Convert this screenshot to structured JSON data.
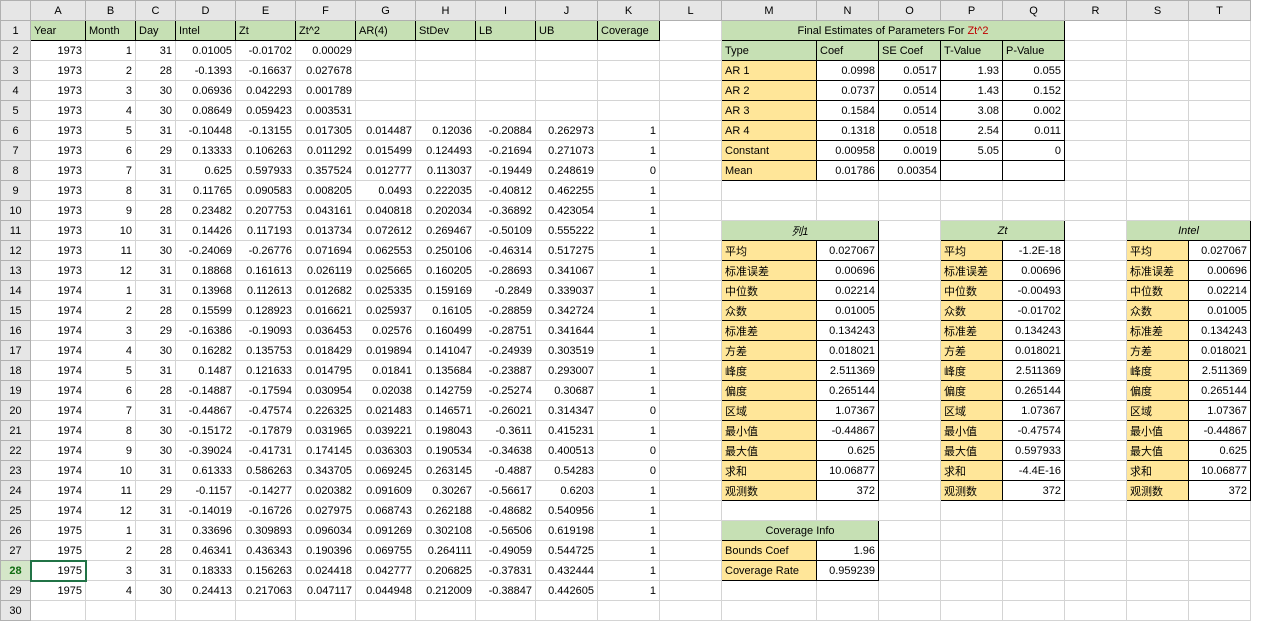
{
  "columns": [
    "A",
    "B",
    "C",
    "D",
    "E",
    "F",
    "G",
    "H",
    "I",
    "J",
    "K",
    "L",
    "M",
    "N",
    "O",
    "P",
    "Q",
    "R",
    "S",
    "T"
  ],
  "headers": {
    "A": "Year",
    "B": "Month",
    "C": "Day",
    "D": "Intel",
    "E": "Zt",
    "F": "Zt^2",
    "G": "AR(4)",
    "H": "StDev",
    "I": "LB",
    "J": "UB",
    "K": "Coverage"
  },
  "rows": [
    {
      "r": 2,
      "A": "1973",
      "B": "1",
      "C": "31",
      "D": "0.01005",
      "E": "-0.01702",
      "F": "0.00029"
    },
    {
      "r": 3,
      "A": "1973",
      "B": "2",
      "C": "28",
      "D": "-0.1393",
      "E": "-0.16637",
      "F": "0.027678"
    },
    {
      "r": 4,
      "A": "1973",
      "B": "3",
      "C": "30",
      "D": "0.06936",
      "E": "0.042293",
      "F": "0.001789"
    },
    {
      "r": 5,
      "A": "1973",
      "B": "4",
      "C": "30",
      "D": "0.08649",
      "E": "0.059423",
      "F": "0.003531"
    },
    {
      "r": 6,
      "A": "1973",
      "B": "5",
      "C": "31",
      "D": "-0.10448",
      "E": "-0.13155",
      "F": "0.017305",
      "G": "0.014487",
      "H": "0.12036",
      "I": "-0.20884",
      "J": "0.262973",
      "K": "1"
    },
    {
      "r": 7,
      "A": "1973",
      "B": "6",
      "C": "29",
      "D": "0.13333",
      "E": "0.106263",
      "F": "0.011292",
      "G": "0.015499",
      "H": "0.124493",
      "I": "-0.21694",
      "J": "0.271073",
      "K": "1"
    },
    {
      "r": 8,
      "A": "1973",
      "B": "7",
      "C": "31",
      "D": "0.625",
      "E": "0.597933",
      "F": "0.357524",
      "G": "0.012777",
      "H": "0.113037",
      "I": "-0.19449",
      "J": "0.248619",
      "K": "0"
    },
    {
      "r": 9,
      "A": "1973",
      "B": "8",
      "C": "31",
      "D": "0.11765",
      "E": "0.090583",
      "F": "0.008205",
      "G": "0.0493",
      "H": "0.222035",
      "I": "-0.40812",
      "J": "0.462255",
      "K": "1"
    },
    {
      "r": 10,
      "A": "1973",
      "B": "9",
      "C": "28",
      "D": "0.23482",
      "E": "0.207753",
      "F": "0.043161",
      "G": "0.040818",
      "H": "0.202034",
      "I": "-0.36892",
      "J": "0.423054",
      "K": "1"
    },
    {
      "r": 11,
      "A": "1973",
      "B": "10",
      "C": "31",
      "D": "0.14426",
      "E": "0.117193",
      "F": "0.013734",
      "G": "0.072612",
      "H": "0.269467",
      "I": "-0.50109",
      "J": "0.555222",
      "K": "1"
    },
    {
      "r": 12,
      "A": "1973",
      "B": "11",
      "C": "30",
      "D": "-0.24069",
      "E": "-0.26776",
      "F": "0.071694",
      "G": "0.062553",
      "H": "0.250106",
      "I": "-0.46314",
      "J": "0.517275",
      "K": "1"
    },
    {
      "r": 13,
      "A": "1973",
      "B": "12",
      "C": "31",
      "D": "0.18868",
      "E": "0.161613",
      "F": "0.026119",
      "G": "0.025665",
      "H": "0.160205",
      "I": "-0.28693",
      "J": "0.341067",
      "K": "1"
    },
    {
      "r": 14,
      "A": "1974",
      "B": "1",
      "C": "31",
      "D": "0.13968",
      "E": "0.112613",
      "F": "0.012682",
      "G": "0.025335",
      "H": "0.159169",
      "I": "-0.2849",
      "J": "0.339037",
      "K": "1"
    },
    {
      "r": 15,
      "A": "1974",
      "B": "2",
      "C": "28",
      "D": "0.15599",
      "E": "0.128923",
      "F": "0.016621",
      "G": "0.025937",
      "H": "0.16105",
      "I": "-0.28859",
      "J": "0.342724",
      "K": "1"
    },
    {
      "r": 16,
      "A": "1974",
      "B": "3",
      "C": "29",
      "D": "-0.16386",
      "E": "-0.19093",
      "F": "0.036453",
      "G": "0.02576",
      "H": "0.160499",
      "I": "-0.28751",
      "J": "0.341644",
      "K": "1"
    },
    {
      "r": 17,
      "A": "1974",
      "B": "4",
      "C": "30",
      "D": "0.16282",
      "E": "0.135753",
      "F": "0.018429",
      "G": "0.019894",
      "H": "0.141047",
      "I": "-0.24939",
      "J": "0.303519",
      "K": "1"
    },
    {
      "r": 18,
      "A": "1974",
      "B": "5",
      "C": "31",
      "D": "0.1487",
      "E": "0.121633",
      "F": "0.014795",
      "G": "0.01841",
      "H": "0.135684",
      "I": "-0.23887",
      "J": "0.293007",
      "K": "1"
    },
    {
      "r": 19,
      "A": "1974",
      "B": "6",
      "C": "28",
      "D": "-0.14887",
      "E": "-0.17594",
      "F": "0.030954",
      "G": "0.02038",
      "H": "0.142759",
      "I": "-0.25274",
      "J": "0.30687",
      "K": "1"
    },
    {
      "r": 20,
      "A": "1974",
      "B": "7",
      "C": "31",
      "D": "-0.44867",
      "E": "-0.47574",
      "F": "0.226325",
      "G": "0.021483",
      "H": "0.146571",
      "I": "-0.26021",
      "J": "0.314347",
      "K": "0"
    },
    {
      "r": 21,
      "A": "1974",
      "B": "8",
      "C": "30",
      "D": "-0.15172",
      "E": "-0.17879",
      "F": "0.031965",
      "G": "0.039221",
      "H": "0.198043",
      "I": "-0.3611",
      "J": "0.415231",
      "K": "1"
    },
    {
      "r": 22,
      "A": "1974",
      "B": "9",
      "C": "30",
      "D": "-0.39024",
      "E": "-0.41731",
      "F": "0.174145",
      "G": "0.036303",
      "H": "0.190534",
      "I": "-0.34638",
      "J": "0.400513",
      "K": "0"
    },
    {
      "r": 23,
      "A": "1974",
      "B": "10",
      "C": "31",
      "D": "0.61333",
      "E": "0.586263",
      "F": "0.343705",
      "G": "0.069245",
      "H": "0.263145",
      "I": "-0.4887",
      "J": "0.54283",
      "K": "0"
    },
    {
      "r": 24,
      "A": "1974",
      "B": "11",
      "C": "29",
      "D": "-0.1157",
      "E": "-0.14277",
      "F": "0.020382",
      "G": "0.091609",
      "H": "0.30267",
      "I": "-0.56617",
      "J": "0.6203",
      "K": "1"
    },
    {
      "r": 25,
      "A": "1974",
      "B": "12",
      "C": "31",
      "D": "-0.14019",
      "E": "-0.16726",
      "F": "0.027975",
      "G": "0.068743",
      "H": "0.262188",
      "I": "-0.48682",
      "J": "0.540956",
      "K": "1"
    },
    {
      "r": 26,
      "A": "1975",
      "B": "1",
      "C": "31",
      "D": "0.33696",
      "E": "0.309893",
      "F": "0.096034",
      "G": "0.091269",
      "H": "0.302108",
      "I": "-0.56506",
      "J": "0.619198",
      "K": "1"
    },
    {
      "r": 27,
      "A": "1975",
      "B": "2",
      "C": "28",
      "D": "0.46341",
      "E": "0.436343",
      "F": "0.190396",
      "G": "0.069755",
      "H": "0.264111",
      "I": "-0.49059",
      "J": "0.544725",
      "K": "1"
    },
    {
      "r": 28,
      "A": "1975",
      "B": "3",
      "C": "31",
      "D": "0.18333",
      "E": "0.156263",
      "F": "0.024418",
      "G": "0.042777",
      "H": "0.206825",
      "I": "-0.37831",
      "J": "0.432444",
      "K": "1"
    },
    {
      "r": 29,
      "A": "1975",
      "B": "4",
      "C": "30",
      "D": "0.24413",
      "E": "0.217063",
      "F": "0.047117",
      "G": "0.044948",
      "H": "0.212009",
      "I": "-0.38847",
      "J": "0.442605",
      "K": "1"
    }
  ],
  "final_estimates": {
    "title_pre": "Final Estimates of Parameters For ",
    "title_red": "Zt^2",
    "cols": [
      "Type",
      "Coef",
      "SE Coef",
      "T-Value",
      "P-Value"
    ],
    "rows": [
      [
        "AR   1",
        "0.0998",
        "0.0517",
        "1.93",
        "0.055"
      ],
      [
        "AR   2",
        "0.0737",
        "0.0514",
        "1.43",
        "0.152"
      ],
      [
        "AR   3",
        "0.1584",
        "0.0514",
        "3.08",
        "0.002"
      ],
      [
        "AR   4",
        "0.1318",
        "0.0518",
        "2.54",
        "0.011"
      ],
      [
        "Constant",
        "0.00958",
        "0.0019",
        "5.05",
        "0"
      ],
      [
        "Mean",
        "0.01786",
        "0.00354",
        "",
        ""
      ]
    ]
  },
  "stats_blocks": [
    {
      "title": "列1",
      "at_col": "M",
      "rows": [
        [
          "平均",
          "0.027067"
        ],
        [
          "标准误差",
          "0.00696"
        ],
        [
          "中位数",
          "0.02214"
        ],
        [
          "众数",
          "0.01005"
        ],
        [
          "标准差",
          "0.134243"
        ],
        [
          "方差",
          "0.018021"
        ],
        [
          "峰度",
          "2.511369"
        ],
        [
          "偏度",
          "0.265144"
        ],
        [
          "区域",
          "1.07367"
        ],
        [
          "最小值",
          "-0.44867"
        ],
        [
          "最大值",
          "0.625"
        ],
        [
          "求和",
          "10.06877"
        ],
        [
          "观测数",
          "372"
        ]
      ]
    },
    {
      "title": "Zt",
      "at_col": "P",
      "rows": [
        [
          "平均",
          "-1.2E-18"
        ],
        [
          "标准误差",
          "0.00696"
        ],
        [
          "中位数",
          "-0.00493"
        ],
        [
          "众数",
          "-0.01702"
        ],
        [
          "标准差",
          "0.134243"
        ],
        [
          "方差",
          "0.018021"
        ],
        [
          "峰度",
          "2.511369"
        ],
        [
          "偏度",
          "0.265144"
        ],
        [
          "区域",
          "1.07367"
        ],
        [
          "最小值",
          "-0.47574"
        ],
        [
          "最大值",
          "0.597933"
        ],
        [
          "求和",
          "-4.4E-16"
        ],
        [
          "观测数",
          "372"
        ]
      ]
    },
    {
      "title": "Intel",
      "at_col": "S",
      "rows": [
        [
          "平均",
          "0.027067"
        ],
        [
          "标准误差",
          "0.00696"
        ],
        [
          "中位数",
          "0.02214"
        ],
        [
          "众数",
          "0.01005"
        ],
        [
          "标准差",
          "0.134243"
        ],
        [
          "方差",
          "0.018021"
        ],
        [
          "峰度",
          "2.511369"
        ],
        [
          "偏度",
          "0.265144"
        ],
        [
          "区域",
          "1.07367"
        ],
        [
          "最小值",
          "-0.44867"
        ],
        [
          "最大值",
          "0.625"
        ],
        [
          "求和",
          "10.06877"
        ],
        [
          "观测数",
          "372"
        ]
      ]
    }
  ],
  "coverage_info": {
    "title": "Coverage Info",
    "rows": [
      [
        "Bounds Coef",
        "1.96"
      ],
      [
        "Coverage Rate",
        "0.959239"
      ]
    ]
  },
  "selected_row": 28
}
